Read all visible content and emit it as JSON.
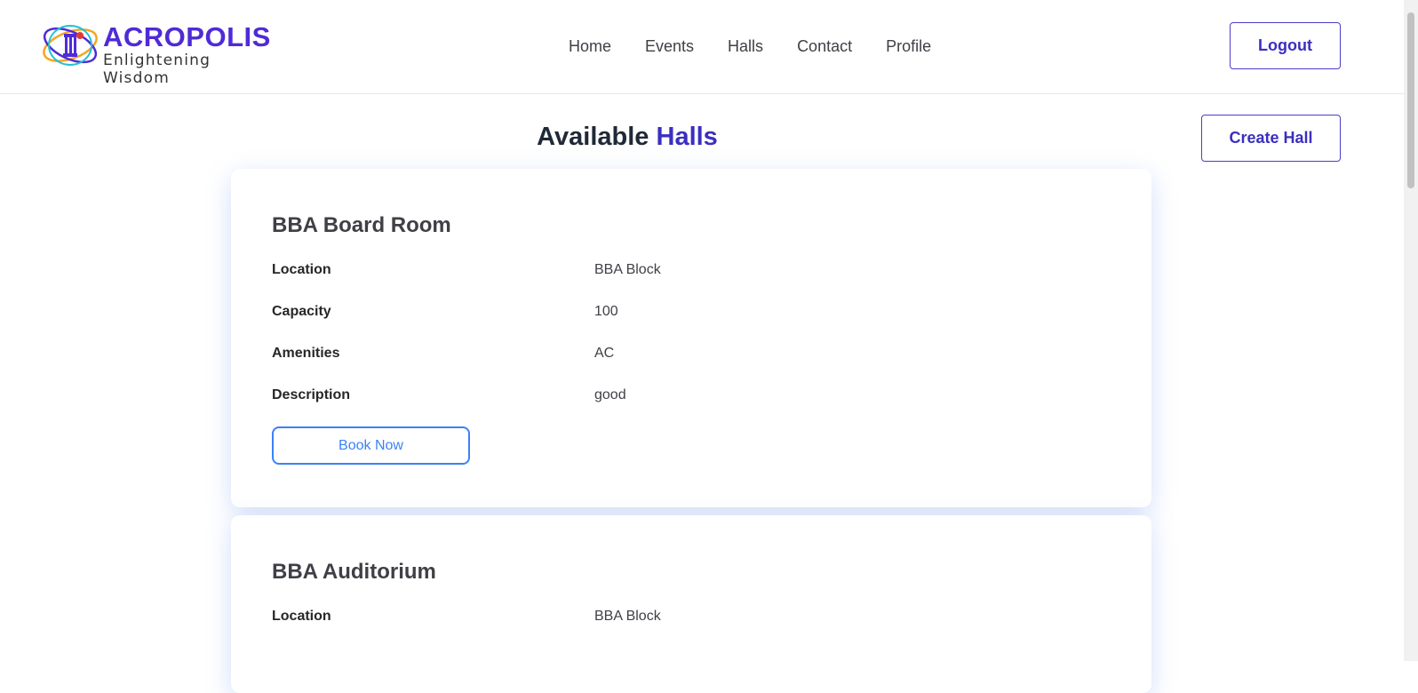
{
  "header": {
    "brand": {
      "name": "ACROPOLIS",
      "tagline": "Enlightening Wisdom"
    },
    "nav": [
      {
        "label": "Home"
      },
      {
        "label": "Events"
      },
      {
        "label": "Halls"
      },
      {
        "label": "Contact"
      },
      {
        "label": "Profile"
      }
    ],
    "logout_label": "Logout"
  },
  "page": {
    "title_part1": "Available",
    "title_part2": "Halls",
    "create_label": "Create Hall"
  },
  "halls": [
    {
      "name": "BBA Board Room",
      "fields": [
        {
          "label": "Location",
          "value": "BBA Block"
        },
        {
          "label": "Capacity",
          "value": "100"
        },
        {
          "label": "Amenities",
          "value": "AC"
        },
        {
          "label": "Description",
          "value": "good"
        }
      ],
      "book_label": "Book Now"
    },
    {
      "name": "BBA Auditorium",
      "fields": [
        {
          "label": "Location",
          "value": "BBA Block"
        }
      ]
    }
  ],
  "colors": {
    "brand": "#4f2bd6",
    "accent": "#3b2fbf",
    "button_blue": "#3b82f6"
  }
}
